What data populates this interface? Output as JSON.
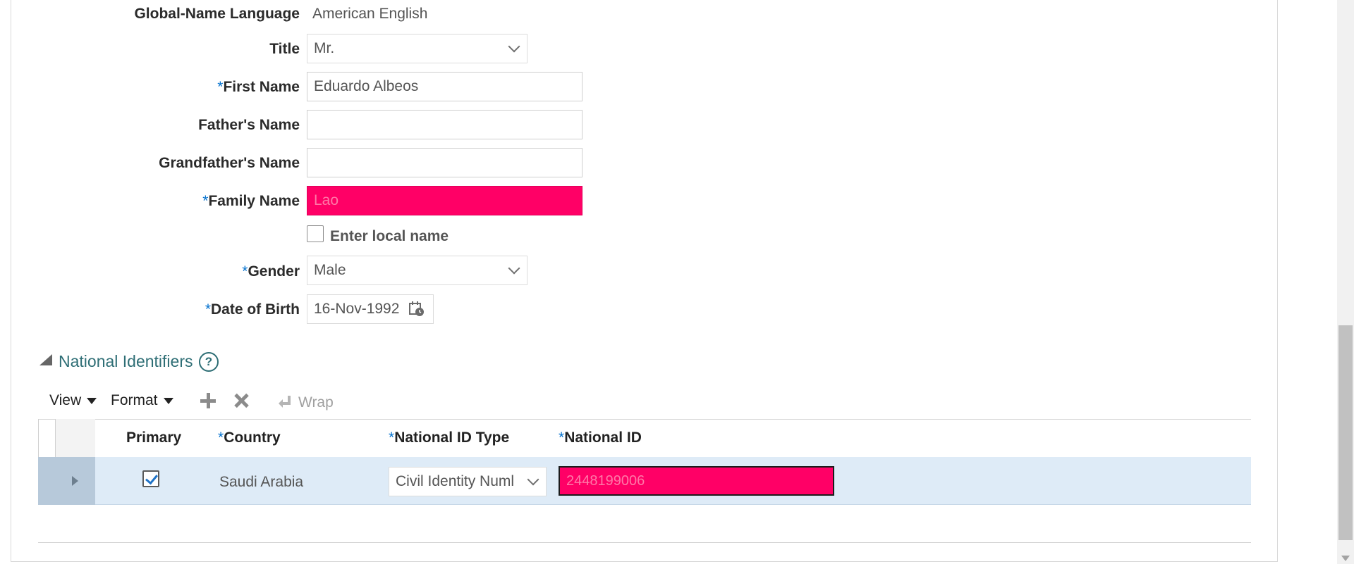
{
  "form": {
    "global_name_language_label": "Global-Name Language",
    "global_name_language_value": "American English",
    "title_label": "Title",
    "title_value": "Mr.",
    "first_name_label": "First Name",
    "first_name_value": "Eduardo Albeos",
    "fathers_name_label": "Father's Name",
    "fathers_name_value": "",
    "grandfathers_name_label": "Grandfather's Name",
    "grandfathers_name_value": "",
    "family_name_label": "Family Name",
    "family_name_value": "Lao",
    "enter_local_name_label": "Enter local name",
    "gender_label": "Gender",
    "gender_value": "Male",
    "dob_label": "Date of Birth",
    "dob_value": "16-Nov-1992",
    "required_marker": "*"
  },
  "national_identifiers": {
    "section_title": "National Identifiers",
    "help_glyph": "?",
    "toolbar": {
      "view_label": "View",
      "format_label": "Format",
      "wrap_label": "Wrap"
    },
    "columns": [
      "Primary",
      "Country",
      "National ID Type",
      "National ID"
    ],
    "rows": [
      {
        "primary": true,
        "country": "Saudi Arabia",
        "national_id_type": "Civil Identity Numl",
        "national_id": "2448199006"
      }
    ]
  },
  "icons": {
    "collapse": "collapse-triangle-icon",
    "help": "help-circle-icon",
    "add": "plus-icon",
    "delete": "x-icon",
    "wrap": "wrap-arrow-icon",
    "calendar": "calendar-icon",
    "dropdown": "chevron-down-icon",
    "row_expand": "expand-triangle-icon"
  },
  "colors": {
    "error_fill": "#ff0066",
    "required_marker": "#0572ce",
    "selected_row": "#deebf7",
    "section_title": "#2e6e75"
  }
}
